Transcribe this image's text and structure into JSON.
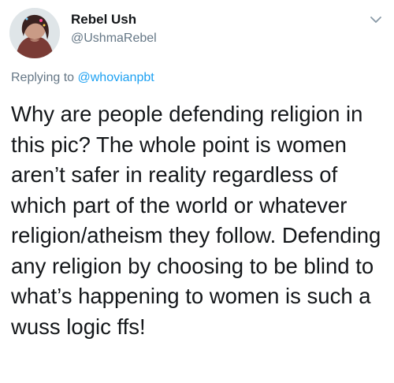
{
  "author": {
    "name": "Rebel Ush",
    "handle": "@UshmaRebel"
  },
  "reply": {
    "prefix": "Replying to ",
    "mention": "@whovianpbt"
  },
  "tweet": {
    "text": "Why are people defending religion in this pic? The whole point is women aren’t safer in reality regardless of which part of the world or whatever religion/atheism they follow. Defending any religion by choosing to be blind to what’s happening to women is such a wuss logic ffs!"
  },
  "icons": {
    "menu": "chevron-down-icon",
    "avatar": "avatar"
  },
  "colors": {
    "text": "#14171a",
    "secondary": "#657786",
    "link": "#1da1f2"
  }
}
